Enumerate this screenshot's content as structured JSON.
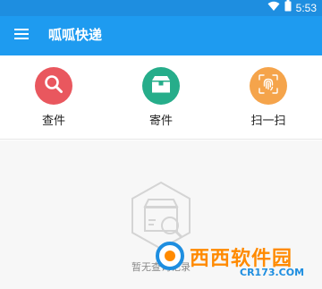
{
  "status_bar": {
    "time": "5:53",
    "wifi_icon": "wifi-icon",
    "battery_icon": "battery-icon"
  },
  "app_bar": {
    "title": "呱呱快递",
    "menu_icon": "menu-icon"
  },
  "actions": [
    {
      "label": "查件",
      "icon": "search-icon",
      "color": "#e9575e"
    },
    {
      "label": "寄件",
      "icon": "package-icon",
      "color": "#26ad8a"
    },
    {
      "label": "扫一扫",
      "icon": "fingerprint-scan-icon",
      "color": "#f5a44b"
    }
  ],
  "empty_state": {
    "text": "暂无查询记录",
    "icon": "empty-package-search-icon"
  },
  "watermark": {
    "name": "西西软件园",
    "url": "CR173.COM"
  }
}
